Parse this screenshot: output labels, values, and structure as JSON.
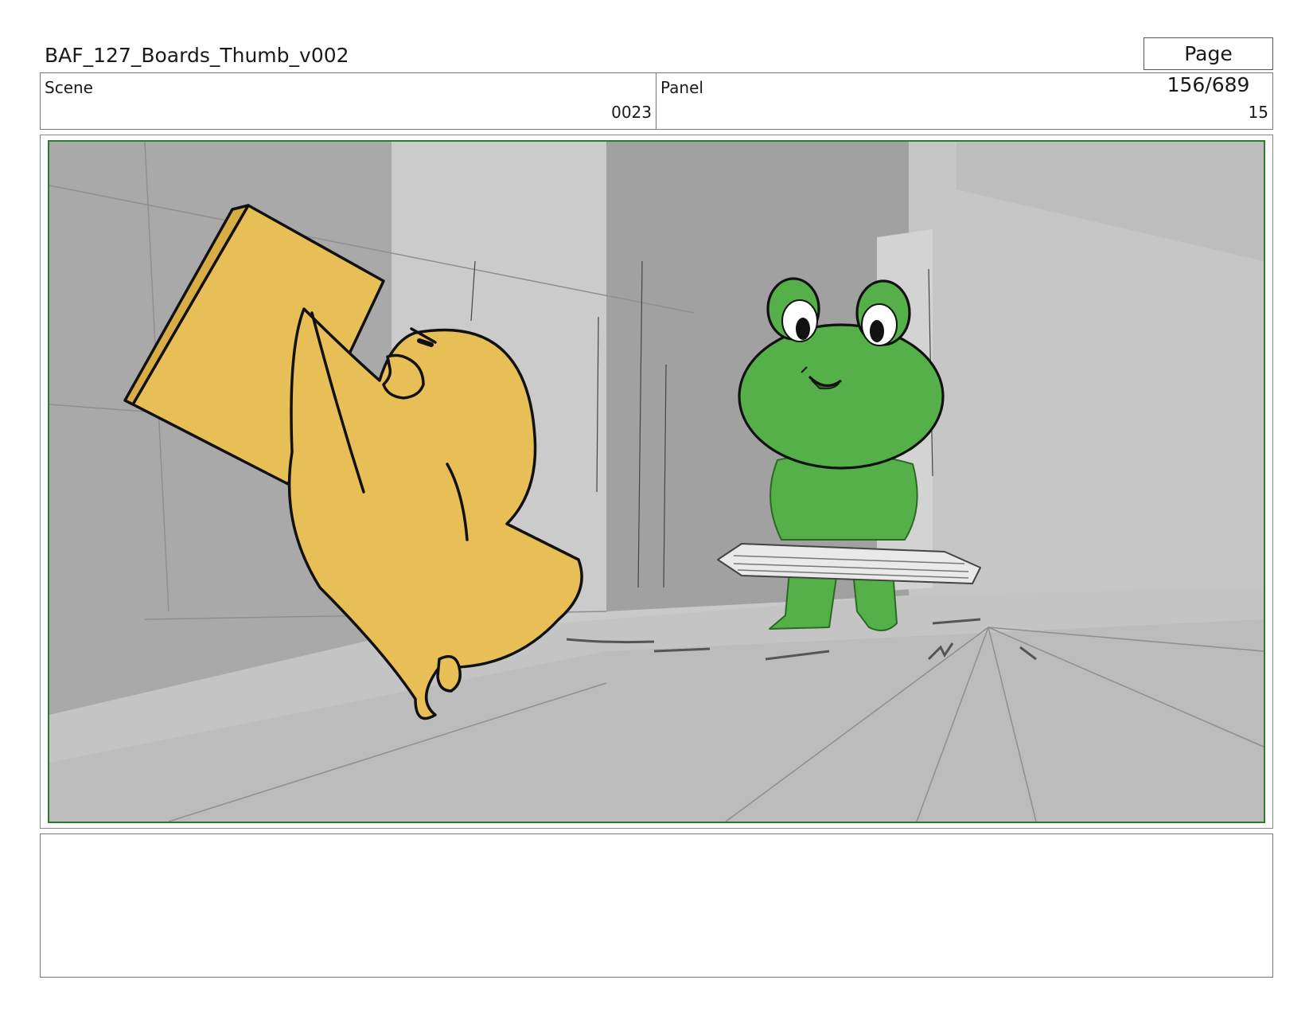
{
  "document": {
    "title": "BAF_127_Boards_Thumb_v002",
    "page_label": "Page 156/689"
  },
  "header": {
    "scene_label": "Scene",
    "scene_value": "0023",
    "panel_label": "Panel",
    "panel_value": "15"
  },
  "frame": {
    "border_color": "#2f7a2f",
    "chick_color": "#e8bf57",
    "frog_color": "#56b04a"
  },
  "notes": {
    "text": ""
  }
}
